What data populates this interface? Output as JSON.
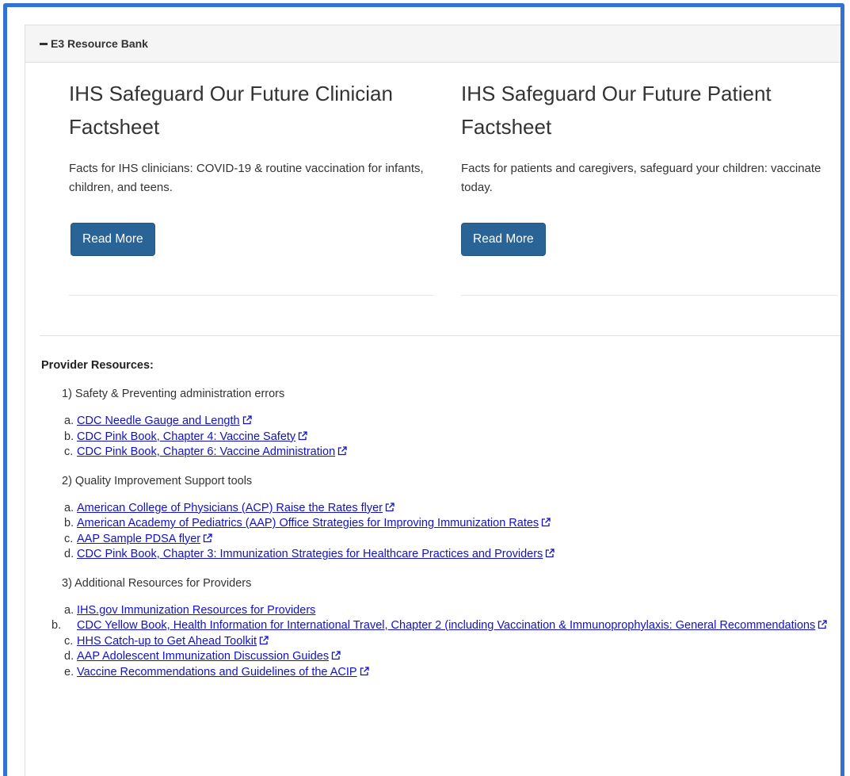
{
  "panel": {
    "title": "E3 Resource Bank"
  },
  "cards": [
    {
      "title": "IHS Safeguard Our Future Clinician Factsheet",
      "description": "Facts for IHS clinicians: COVID-19 & routine vaccination for infants, children, and teens.",
      "button": "Read More"
    },
    {
      "title": "IHS Safeguard Our Future Patient Factsheet",
      "description": "Facts for patients and caregivers, safeguard your children: vaccinate today.",
      "button": "Read More"
    }
  ],
  "resources": {
    "title": "Provider Resources:",
    "sections": [
      {
        "heading": "1) Safety & Preventing administration errors",
        "items": [
          {
            "mark": "a.",
            "label": "CDC Needle Gauge and Length"
          },
          {
            "mark": "b.",
            "label": "CDC Pink Book, Chapter 4: Vaccine Safety"
          },
          {
            "mark": "c.",
            "label": "CDC Pink Book, Chapter 6: Vaccine Administration"
          }
        ]
      },
      {
        "heading": "2) Quality Improvement Support tools",
        "items": [
          {
            "mark": "a.",
            "label": "American College of Physicians (ACP) Raise the Rates flyer"
          },
          {
            "mark": "b.",
            "label": "American Academy of Pediatrics (AAP) Office Strategies for Improving Immunization Rates"
          },
          {
            "mark": "c.",
            "label": "AAP Sample PDSA flyer"
          },
          {
            "mark": "d.",
            "label": "CDC Pink Book, Chapter 3: Immunization Strategies for Healthcare Practices and Providers"
          }
        ]
      },
      {
        "heading": "3) Additional Resources for Providers",
        "items": [
          {
            "mark": "a.",
            "label": "IHS.gov Immunization Resources for Providers"
          },
          {
            "mark": "b.",
            "label": "CDC Yellow Book, Health Information for International Travel, Chapter 2 (including Vaccination & Immunoprophylaxis: General Recommendations"
          },
          {
            "mark": "c.",
            "label": "HHS Catch-up to Get Ahead Toolkit"
          },
          {
            "mark": "d.",
            "label": "AAP Adolescent Immunization Discussion Guides"
          },
          {
            "mark": "e.",
            "label": "Vaccine Recommendations and Guidelines of the ACIP"
          }
        ]
      }
    ]
  }
}
